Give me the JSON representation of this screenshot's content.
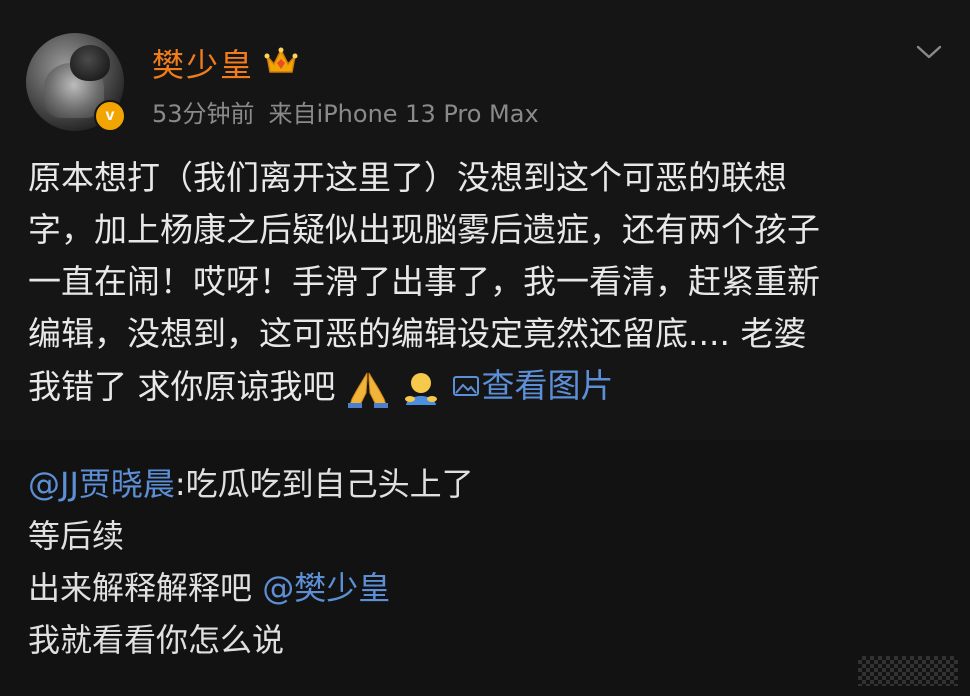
{
  "post": {
    "username": "樊少皇",
    "time": "53分钟前",
    "source": "来自iPhone 13 Pro Max",
    "lines": [
      "原本想打（我们离开这里了）没想到这个可恶的联想",
      "字，加上杨康之后疑似出现脳雾后遗症，还有两个孩子",
      "一直在闹！哎呀！手滑了出事了，我一看清，赶紧重新",
      "编辑，没想到，这可恶的编辑设定竟然还留底.... 老婆",
      "我错了 求你原谅我吧"
    ],
    "emojis": [
      "praying-hands-icon",
      "person-bowing-icon"
    ],
    "view_picture": "查看图片"
  },
  "comment": {
    "mention1": "@JJ贾晓晨",
    "text1": ":吃瓜吃到自己头上了",
    "line2": "等后续",
    "line3_prefix": "出来解释解释吧 ",
    "mention2": "@樊少皇",
    "line4": "我就看看你怎么说"
  },
  "colors": {
    "username": "#f07c1b",
    "link": "#5c8fd6",
    "verified": "#f2a500",
    "background": "#121212"
  }
}
